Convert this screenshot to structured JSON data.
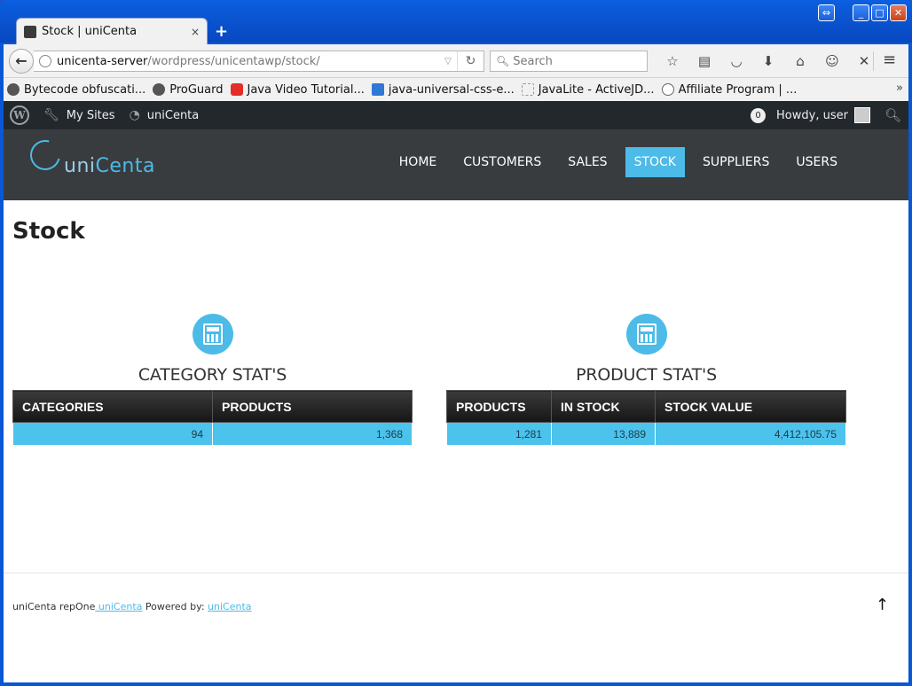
{
  "browser": {
    "tab_title": "Stock | uniCenta",
    "tab_close": "×",
    "new_tab": "+",
    "url_host": "unicenta-server",
    "url_path": "/wordpress/unicentawp/stock/",
    "search_placeholder": "Search",
    "bookmarks": [
      {
        "label": "Bytecode obfuscati...",
        "icon": "globe-icon"
      },
      {
        "label": "ProGuard",
        "icon": "proguard-icon"
      },
      {
        "label": "Java Video Tutorial...",
        "icon": "youtube-icon"
      },
      {
        "label": "java-universal-css-e...",
        "icon": "bookmark-icon"
      },
      {
        "label": "JavaLite - ActiveJD...",
        "icon": "blank-page-icon"
      },
      {
        "label": "Affiliate Program | ...",
        "icon": "wordpress-icon"
      }
    ],
    "bookmarks_more": "»"
  },
  "adminbar": {
    "my_sites": "My Sites",
    "site_name": "uniCenta",
    "comments_count": "0",
    "howdy": "Howdy, user"
  },
  "site": {
    "logo_prefix": "uni",
    "logo_suffix": "Centa",
    "nav": [
      {
        "label": "HOME",
        "active": false
      },
      {
        "label": "CUSTOMERS",
        "active": false
      },
      {
        "label": "SALES",
        "active": false
      },
      {
        "label": "STOCK",
        "active": true
      },
      {
        "label": "SUPPLIERS",
        "active": false
      },
      {
        "label": "USERS",
        "active": false
      }
    ],
    "accent_color": "#4cbbe8"
  },
  "page": {
    "title": "Stock",
    "category_panel": {
      "title": "CATEGORY STAT'S",
      "headers": [
        "CATEGORIES",
        "PRODUCTS"
      ],
      "row": [
        "94",
        "1,368"
      ]
    },
    "product_panel": {
      "title": "PRODUCT STAT'S",
      "headers": [
        "PRODUCTS",
        "IN STOCK",
        "STOCK VALUE"
      ],
      "row": [
        "1,281",
        "13,889",
        "4,412,105.75"
      ]
    }
  },
  "footer": {
    "prefix": "uniCenta repOne",
    "link1": " uniCenta",
    "middle": " Powered by: ",
    "link2": "uniCenta",
    "to_top": "↑"
  }
}
